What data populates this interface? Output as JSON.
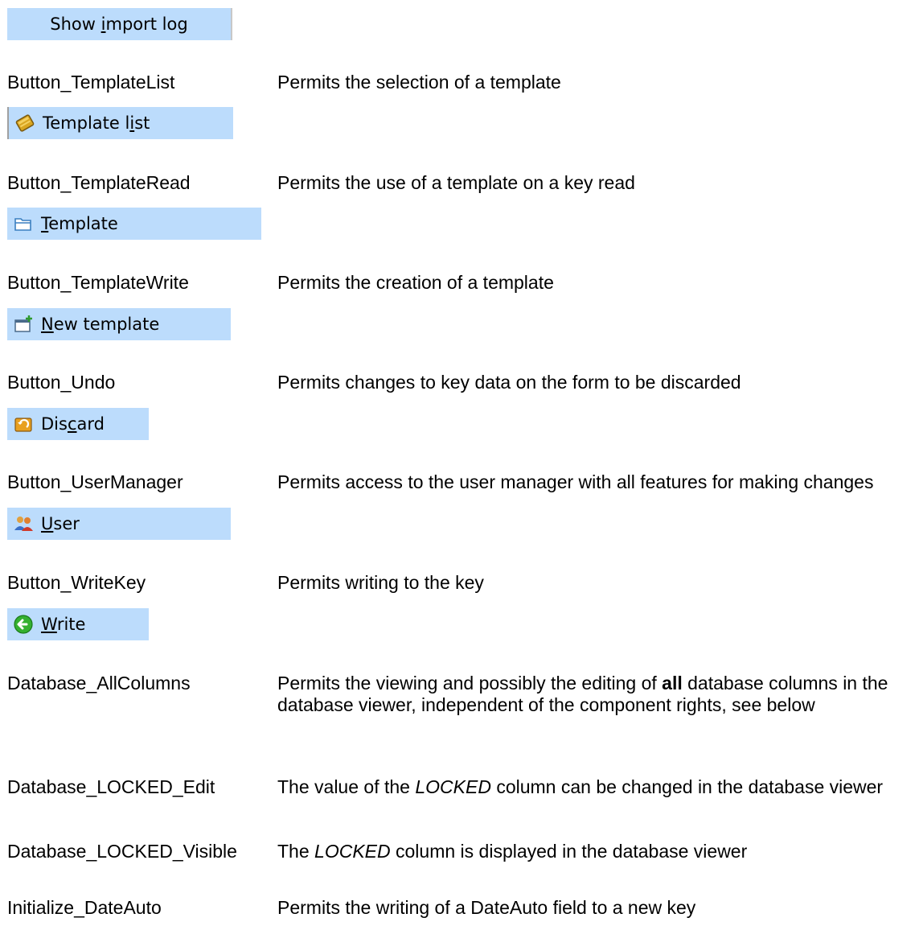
{
  "buttons": {
    "import_log": {
      "pre": "Show ",
      "ul": "i",
      "post": "mport log"
    },
    "template_list": {
      "pre": "Template l",
      "ul": "i",
      "post": "st",
      "icon": "template-book-icon"
    },
    "template": {
      "pre": "",
      "ul": "T",
      "post": "emplate",
      "icon": "folder-open-icon"
    },
    "new_template": {
      "pre": "",
      "ul": "N",
      "post": "ew template",
      "icon": "new-template-icon"
    },
    "discard": {
      "pre": "Dis",
      "ul": "c",
      "post": "ard",
      "icon": "discard-icon"
    },
    "user": {
      "pre": "",
      "ul": "U",
      "post": "ser",
      "icon": "users-icon"
    },
    "write": {
      "pre": "",
      "ul": "W",
      "post": "rite",
      "icon": "write-arrow-icon"
    }
  },
  "rights": [
    {
      "name": "Button_TemplateList",
      "desc": "Permits the selection of a template"
    },
    {
      "name": "Button_TemplateRead",
      "desc": "Permits the use of a template on a key read"
    },
    {
      "name": "Button_TemplateWrite",
      "desc": "Permits the creation of a template"
    },
    {
      "name": "Button_Undo",
      "desc": "Permits changes to key data on the form to be discarded"
    },
    {
      "name": "Button_UserManager",
      "desc": "Permits access to the user manager with all features for making changes"
    },
    {
      "name": "Button_WriteKey",
      "desc": "Permits writing to the key"
    },
    {
      "name": "Database_AllColumns",
      "desc_pre": "Permits the viewing and possibly the editing of ",
      "desc_bold": "all",
      "desc_post": " database columns in the database viewer, independent of the component rights, see below"
    },
    {
      "name": "Database_LOCKED_Edit",
      "desc_pre": "The value of the ",
      "desc_italic": "LOCKED",
      "desc_post": " column can be changed in the database viewer"
    },
    {
      "name": "Database_LOCKED_Visible",
      "desc_pre": "The ",
      "desc_italic": "LOCKED",
      "desc_post": " column is displayed in the database viewer"
    },
    {
      "name": "Initialize_DateAuto",
      "desc": "Permits the writing of a DateAuto field to a new key"
    }
  ]
}
